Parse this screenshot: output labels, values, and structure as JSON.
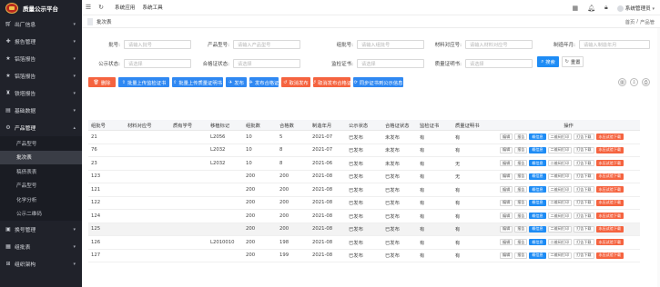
{
  "app": {
    "title": "质量公示平台"
  },
  "sidebar": {
    "menu_top": [
      {
        "label": "出厂信息",
        "icon": "cart-icon"
      },
      {
        "label": "报告管理",
        "icon": "plus-icon"
      },
      {
        "label": "铝箔报告",
        "icon": "star-icon"
      },
      {
        "label": "铝箔报告",
        "icon": "star-icon"
      },
      {
        "label": "铁塔报告",
        "icon": "tower-icon"
      },
      {
        "label": "基础数据",
        "icon": "database-icon"
      }
    ],
    "product_menu": {
      "label": "产品管理",
      "icon": "gear-icon"
    },
    "sub_items": [
      {
        "label": "产品型号",
        "active": false
      },
      {
        "label": "批次表",
        "active": true
      },
      {
        "label": "稿债表表",
        "active": false
      },
      {
        "label": "产品型号",
        "active": false
      },
      {
        "label": "化学分析",
        "active": false
      },
      {
        "label": "公示二维码",
        "active": false
      }
    ],
    "menu_bottom": [
      {
        "label": "换号管理",
        "icon": "cube-icon"
      },
      {
        "label": "组批表",
        "icon": "grid-icon"
      },
      {
        "label": "组织架构",
        "icon": "org-icon"
      }
    ]
  },
  "topbar": {
    "links": [
      "系统应用",
      "系统工具"
    ],
    "user": "系统管理员"
  },
  "tabs": {
    "current": "批次表"
  },
  "breadcrumb": {
    "home": "首页",
    "sep": "/",
    "current": "产品管"
  },
  "filters": [
    {
      "label": "批号:",
      "placeholder": "请输入批号"
    },
    {
      "label": "产品型号:",
      "placeholder": "请输入产品型号"
    },
    {
      "label": "组批号:",
      "placeholder": "请输入组批号"
    },
    {
      "label": "材料对应号:",
      "placeholder": "请输入材料对应号"
    },
    {
      "label": "制造年月:",
      "placeholder": "请输入制造年月"
    },
    {
      "label": "公示状态:",
      "placeholder": "请选择"
    },
    {
      "label": "合格证状态:",
      "placeholder": "请选择"
    },
    {
      "label": "监检证书:",
      "placeholder": "请选择"
    },
    {
      "label": "质量证明书:",
      "placeholder": "请选择"
    }
  ],
  "search_btn": "搜索",
  "reset_btn": "重置",
  "toolbar": [
    {
      "label": "删除",
      "color": "#f5633f"
    },
    {
      "label": "批量上传监检证书",
      "color": "#2f88f2"
    },
    {
      "label": "批量上传质量证明书",
      "color": "#2f88f2"
    },
    {
      "label": "发布",
      "color": "#2f88f2"
    },
    {
      "label": "发布合格证",
      "color": "#2f88f2"
    },
    {
      "label": "取消发布",
      "color": "#f5633f"
    },
    {
      "label": "取消发布合格证",
      "color": "#f5633f"
    },
    {
      "label": "同步证书到公示信息",
      "color": "#2f88f2"
    }
  ],
  "table": {
    "headers": [
      "组批号",
      "材料对应号",
      "质有学号",
      "移植标记",
      "组批数",
      "合格数",
      "制造年月",
      "公示状态",
      "合格证状态",
      "监检证书",
      "质量证明书",
      "操作"
    ],
    "rows": [
      [
        "21",
        "",
        "",
        "L2056",
        "10",
        "5",
        "2021-07",
        "已发布",
        "未发布",
        "有",
        "有"
      ],
      [
        "76",
        "",
        "",
        "L2032",
        "10",
        "8",
        "2021-07",
        "已发布",
        "未发布",
        "有",
        "有"
      ],
      [
        "23",
        "",
        "",
        "L2032",
        "10",
        "8",
        "2021-06",
        "已发布",
        "未发布",
        "有",
        "无"
      ],
      [
        "123",
        "",
        "",
        "",
        "200",
        "200",
        "2021-08",
        "已发布",
        "已发布",
        "有",
        "无"
      ],
      [
        "121",
        "",
        "",
        "",
        "200",
        "200",
        "2021-08",
        "已发布",
        "已发布",
        "有",
        "有"
      ],
      [
        "122",
        "",
        "",
        "",
        "200",
        "200",
        "2021-08",
        "已发布",
        "已发布",
        "有",
        "有"
      ],
      [
        "124",
        "",
        "",
        "",
        "200",
        "200",
        "2021-08",
        "已发布",
        "已发布",
        "有",
        "有"
      ],
      [
        "125",
        "",
        "",
        "",
        "200",
        "200",
        "2021-08",
        "已发布",
        "已发布",
        "有",
        "有"
      ],
      [
        "126",
        "",
        "",
        "L2010010",
        "200",
        "198",
        "2021-08",
        "已发布",
        "已发布",
        "有",
        "有"
      ],
      [
        "127",
        "",
        "",
        "",
        "200",
        "199",
        "2021-08",
        "已发布",
        "已发布",
        "有",
        "有"
      ]
    ],
    "row_actions": [
      "编辑",
      "报告",
      "概信息",
      "二维码打印",
      "打告下载",
      "水压试验下载"
    ]
  }
}
